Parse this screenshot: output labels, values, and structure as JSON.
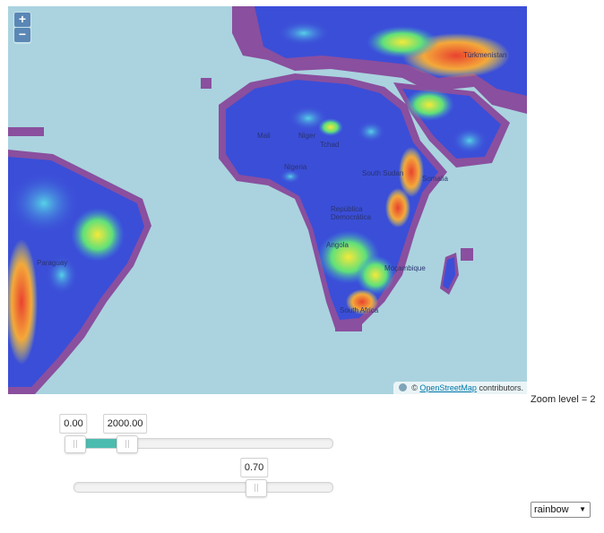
{
  "map": {
    "zoom_in_label": "+",
    "zoom_out_label": "−",
    "attribution_prefix": "©",
    "attribution_link": "OpenStreetMap",
    "attribution_suffix": "contributors.",
    "zoom_level_text": "Zoom level = 2",
    "place_labels": [
      "Mali",
      "Niger",
      "Tchad",
      "Nigeria",
      "South Sudan",
      "Somalia",
      "República Democrática",
      "Angola",
      "Moçambique",
      "South Africa",
      "Paraguay",
      "Türkmenistan"
    ]
  },
  "range_slider": {
    "min_value": "0.00",
    "max_value": "2000.00",
    "low_fraction": 0.0,
    "high_fraction": 0.2
  },
  "opacity_slider": {
    "value": "0.70",
    "fraction": 0.7
  },
  "colormap_select": {
    "selected": "rainbow"
  },
  "colors": {
    "water": "#aad3df",
    "slider_fill": "#4dbcb0",
    "elev_low": "#3b4ed8",
    "elev_mid": "#56d2e6",
    "elev_high": "#f4e93a",
    "elev_peak": "#e8422f",
    "nodata": "#8a4f9e"
  }
}
